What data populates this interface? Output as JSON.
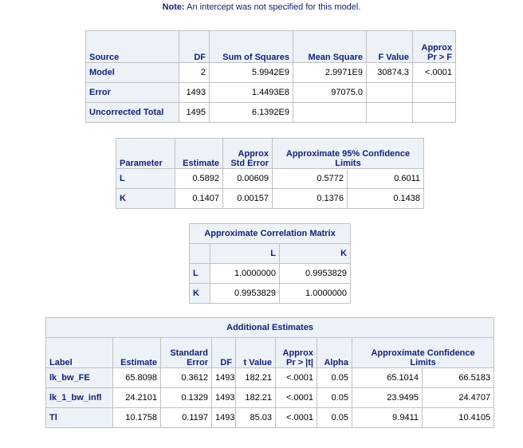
{
  "note": {
    "label": "Note:",
    "text": "An intercept was not specified for this model."
  },
  "anova": {
    "headers": {
      "source": "Source",
      "df": "DF",
      "ss": "Sum of Squares",
      "ms": "Mean Square",
      "f": "F Value",
      "p_line1": "Approx",
      "p_line2": "Pr > F"
    },
    "rows": [
      {
        "source": "Model",
        "df": "2",
        "ss": "5.9942E9",
        "ms": "2.9971E9",
        "f": "30874.3",
        "p": "<.0001"
      },
      {
        "source": "Error",
        "df": "1493",
        "ss": "1.4493E8",
        "ms": "97075.0",
        "f": "",
        "p": ""
      },
      {
        "source": "Uncorrected Total",
        "df": "1495",
        "ss": "6.1392E9",
        "ms": "",
        "f": "",
        "p": ""
      }
    ]
  },
  "params": {
    "headers": {
      "parameter": "Parameter",
      "estimate": "Estimate",
      "se_line1": "Approx",
      "se_line2": "Std Error",
      "ci_line1": "Approximate 95% Confidence",
      "ci_line2": "Limits"
    },
    "rows": [
      {
        "name": "L",
        "estimate": "0.5892",
        "se": "0.00609",
        "lower": "0.5772",
        "upper": "0.6011"
      },
      {
        "name": "K",
        "estimate": "0.1407",
        "se": "0.00157",
        "lower": "0.1376",
        "upper": "0.1438"
      }
    ]
  },
  "corr": {
    "title": "Approximate Correlation Matrix",
    "cols": [
      "L",
      "K"
    ],
    "rows": [
      {
        "name": "L",
        "values": [
          "1.0000000",
          "0.9953829"
        ]
      },
      {
        "name": "K",
        "values": [
          "0.9953829",
          "1.0000000"
        ]
      }
    ]
  },
  "additional": {
    "title": "Additional Estimates",
    "headers": {
      "label": "Label",
      "estimate": "Estimate",
      "se_line1": "Standard",
      "se_line2": "Error",
      "df": "DF",
      "t": "t Value",
      "p_line1": "Approx",
      "p_line2": "Pr > |t|",
      "alpha": "Alpha",
      "ci_line1": "Approximate Confidence",
      "ci_line2": "Limits"
    },
    "rows": [
      {
        "label": "lk_bw_FE",
        "estimate": "65.8098",
        "se": "0.3612",
        "df": "1493",
        "t": "182.21",
        "p": "<.0001",
        "alpha": "0.05",
        "lower": "65.1014",
        "upper": "66.5183"
      },
      {
        "label": "lk_1_bw_infl",
        "estimate": "24.2101",
        "se": "0.1329",
        "df": "1493",
        "t": "182.21",
        "p": "<.0001",
        "alpha": "0.05",
        "lower": "23.9495",
        "upper": "24.4707"
      },
      {
        "label": "Tl",
        "estimate": "10.1758",
        "se": "0.1197",
        "df": "1493",
        "t": "85.03",
        "p": "<.0001",
        "alpha": "0.05",
        "lower": "9.9411",
        "upper": "10.4105"
      }
    ]
  }
}
